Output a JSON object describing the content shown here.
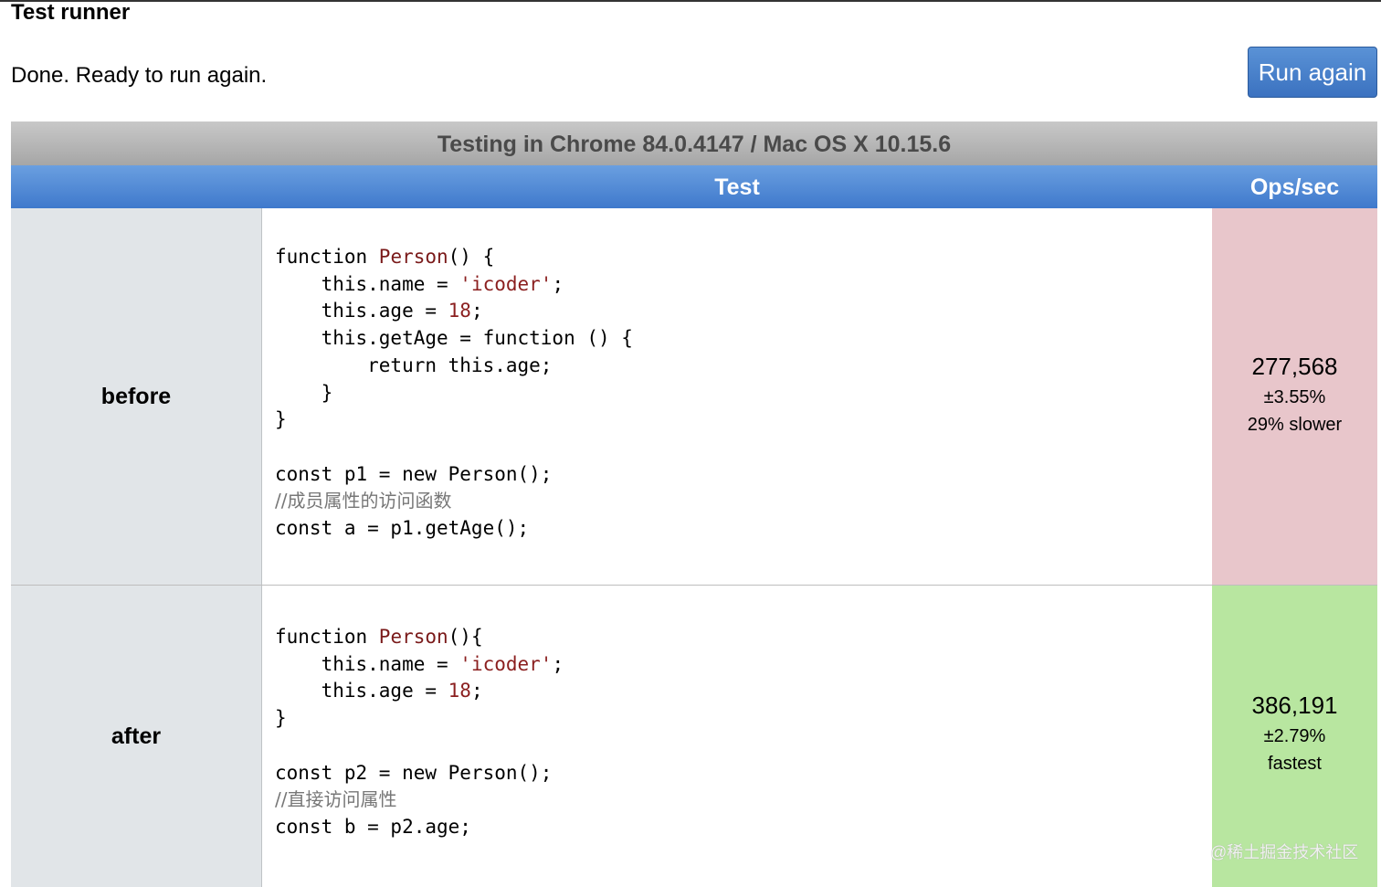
{
  "page": {
    "title": "Test runner",
    "status": "Done. Ready to run again.",
    "run_button": "Run again"
  },
  "table": {
    "caption": "Testing in Chrome 84.0.4147 / Mac OS X 10.15.6",
    "columns": [
      "",
      "Test",
      "Ops/sec"
    ],
    "rows": [
      {
        "name": "before",
        "code_lines": [
          "function Person() {",
          "    this.name = 'icoder';",
          "    this.age = 18;",
          "    this.getAge = function () {",
          "        return this.age;",
          "    }",
          "}",
          "",
          "const p1 = new Person();",
          "//成员属性的访问函数",
          "const a = p1.getAge();"
        ],
        "ops": "277,568",
        "error": "±3.55%",
        "verdict": "29% slower",
        "result_color": "#e8c6cb"
      },
      {
        "name": "after",
        "code_lines": [
          "function Person(){",
          "    this.name = 'icoder';",
          "    this.age = 18;",
          "}",
          "",
          "const p2 = new Person();",
          "//直接访问属性",
          "const b = p2.age;"
        ],
        "ops": "386,191",
        "error": "±2.79%",
        "verdict": "fastest",
        "result_color": "#b8e6a0"
      }
    ]
  },
  "watermark": "@稀土掘金技术社区",
  "colors": {
    "header_blue": "#3f79cc",
    "caption_gray": "#a6a6a6",
    "slower_bg": "#e8c6cb",
    "fastest_bg": "#b8e6a0"
  }
}
